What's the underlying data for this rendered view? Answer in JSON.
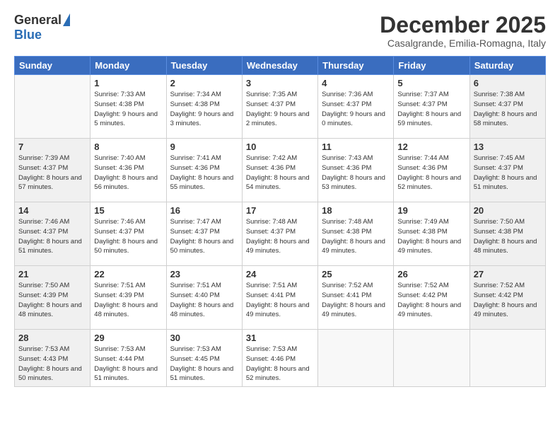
{
  "logo": {
    "general": "General",
    "blue": "Blue"
  },
  "title": "December 2025",
  "location": "Casalgrande, Emilia-Romagna, Italy",
  "headers": [
    "Sunday",
    "Monday",
    "Tuesday",
    "Wednesday",
    "Thursday",
    "Friday",
    "Saturday"
  ],
  "weeks": [
    [
      {
        "day": "",
        "info": ""
      },
      {
        "day": "1",
        "info": "Sunrise: 7:33 AM\nSunset: 4:38 PM\nDaylight: 9 hours\nand 5 minutes."
      },
      {
        "day": "2",
        "info": "Sunrise: 7:34 AM\nSunset: 4:38 PM\nDaylight: 9 hours\nand 3 minutes."
      },
      {
        "day": "3",
        "info": "Sunrise: 7:35 AM\nSunset: 4:37 PM\nDaylight: 9 hours\nand 2 minutes."
      },
      {
        "day": "4",
        "info": "Sunrise: 7:36 AM\nSunset: 4:37 PM\nDaylight: 9 hours\nand 0 minutes."
      },
      {
        "day": "5",
        "info": "Sunrise: 7:37 AM\nSunset: 4:37 PM\nDaylight: 8 hours\nand 59 minutes."
      },
      {
        "day": "6",
        "info": "Sunrise: 7:38 AM\nSunset: 4:37 PM\nDaylight: 8 hours\nand 58 minutes."
      }
    ],
    [
      {
        "day": "7",
        "info": "Sunrise: 7:39 AM\nSunset: 4:37 PM\nDaylight: 8 hours\nand 57 minutes."
      },
      {
        "day": "8",
        "info": "Sunrise: 7:40 AM\nSunset: 4:36 PM\nDaylight: 8 hours\nand 56 minutes."
      },
      {
        "day": "9",
        "info": "Sunrise: 7:41 AM\nSunset: 4:36 PM\nDaylight: 8 hours\nand 55 minutes."
      },
      {
        "day": "10",
        "info": "Sunrise: 7:42 AM\nSunset: 4:36 PM\nDaylight: 8 hours\nand 54 minutes."
      },
      {
        "day": "11",
        "info": "Sunrise: 7:43 AM\nSunset: 4:36 PM\nDaylight: 8 hours\nand 53 minutes."
      },
      {
        "day": "12",
        "info": "Sunrise: 7:44 AM\nSunset: 4:36 PM\nDaylight: 8 hours\nand 52 minutes."
      },
      {
        "day": "13",
        "info": "Sunrise: 7:45 AM\nSunset: 4:37 PM\nDaylight: 8 hours\nand 51 minutes."
      }
    ],
    [
      {
        "day": "14",
        "info": "Sunrise: 7:46 AM\nSunset: 4:37 PM\nDaylight: 8 hours\nand 51 minutes."
      },
      {
        "day": "15",
        "info": "Sunrise: 7:46 AM\nSunset: 4:37 PM\nDaylight: 8 hours\nand 50 minutes."
      },
      {
        "day": "16",
        "info": "Sunrise: 7:47 AM\nSunset: 4:37 PM\nDaylight: 8 hours\nand 50 minutes."
      },
      {
        "day": "17",
        "info": "Sunrise: 7:48 AM\nSunset: 4:37 PM\nDaylight: 8 hours\nand 49 minutes."
      },
      {
        "day": "18",
        "info": "Sunrise: 7:48 AM\nSunset: 4:38 PM\nDaylight: 8 hours\nand 49 minutes."
      },
      {
        "day": "19",
        "info": "Sunrise: 7:49 AM\nSunset: 4:38 PM\nDaylight: 8 hours\nand 49 minutes."
      },
      {
        "day": "20",
        "info": "Sunrise: 7:50 AM\nSunset: 4:38 PM\nDaylight: 8 hours\nand 48 minutes."
      }
    ],
    [
      {
        "day": "21",
        "info": "Sunrise: 7:50 AM\nSunset: 4:39 PM\nDaylight: 8 hours\nand 48 minutes."
      },
      {
        "day": "22",
        "info": "Sunrise: 7:51 AM\nSunset: 4:39 PM\nDaylight: 8 hours\nand 48 minutes."
      },
      {
        "day": "23",
        "info": "Sunrise: 7:51 AM\nSunset: 4:40 PM\nDaylight: 8 hours\nand 48 minutes."
      },
      {
        "day": "24",
        "info": "Sunrise: 7:51 AM\nSunset: 4:41 PM\nDaylight: 8 hours\nand 49 minutes."
      },
      {
        "day": "25",
        "info": "Sunrise: 7:52 AM\nSunset: 4:41 PM\nDaylight: 8 hours\nand 49 minutes."
      },
      {
        "day": "26",
        "info": "Sunrise: 7:52 AM\nSunset: 4:42 PM\nDaylight: 8 hours\nand 49 minutes."
      },
      {
        "day": "27",
        "info": "Sunrise: 7:52 AM\nSunset: 4:42 PM\nDaylight: 8 hours\nand 49 minutes."
      }
    ],
    [
      {
        "day": "28",
        "info": "Sunrise: 7:53 AM\nSunset: 4:43 PM\nDaylight: 8 hours\nand 50 minutes."
      },
      {
        "day": "29",
        "info": "Sunrise: 7:53 AM\nSunset: 4:44 PM\nDaylight: 8 hours\nand 51 minutes."
      },
      {
        "day": "30",
        "info": "Sunrise: 7:53 AM\nSunset: 4:45 PM\nDaylight: 8 hours\nand 51 minutes."
      },
      {
        "day": "31",
        "info": "Sunrise: 7:53 AM\nSunset: 4:46 PM\nDaylight: 8 hours\nand 52 minutes."
      },
      {
        "day": "",
        "info": ""
      },
      {
        "day": "",
        "info": ""
      },
      {
        "day": "",
        "info": ""
      }
    ]
  ]
}
